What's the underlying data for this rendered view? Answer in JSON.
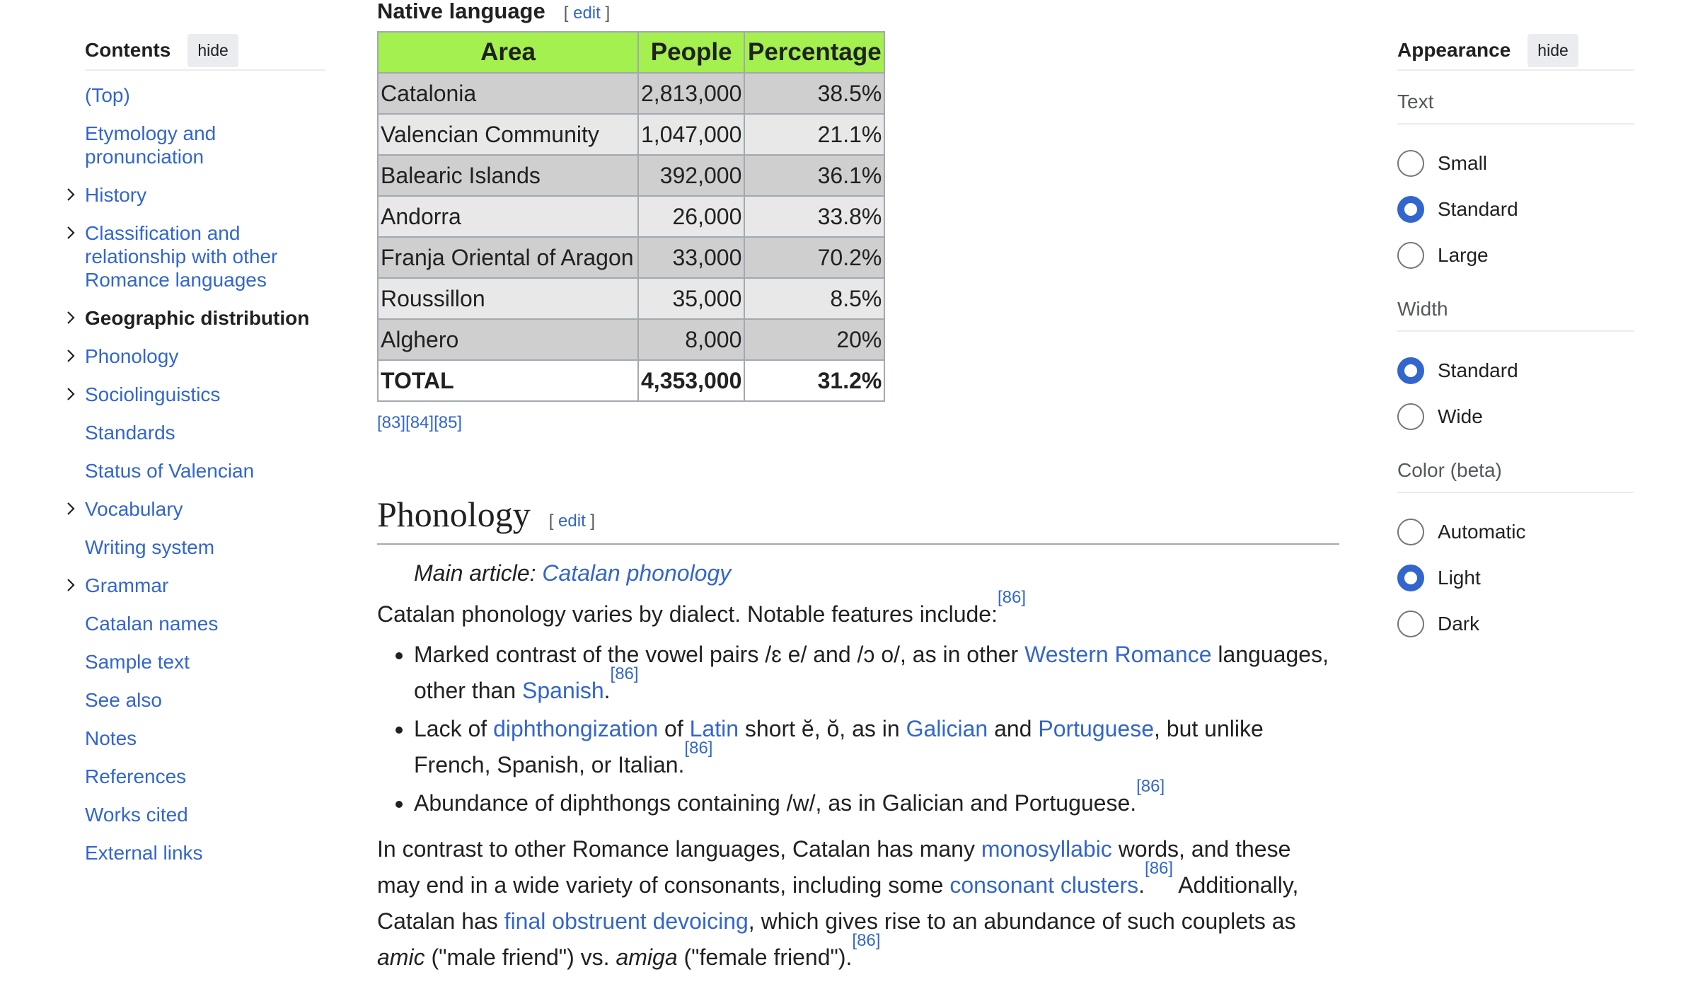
{
  "toc": {
    "title": "Contents",
    "hide_label": "hide",
    "items": [
      {
        "label": "(Top)",
        "expandable": false,
        "active": false
      },
      {
        "label": "Etymology and pronunciation",
        "expandable": false,
        "active": false
      },
      {
        "label": "History",
        "expandable": true,
        "active": false
      },
      {
        "label": "Classification and relationship with other Romance languages",
        "expandable": true,
        "active": false
      },
      {
        "label": "Geographic distribution",
        "expandable": true,
        "active": true
      },
      {
        "label": "Phonology",
        "expandable": true,
        "active": false
      },
      {
        "label": "Sociolinguistics",
        "expandable": true,
        "active": false
      },
      {
        "label": "Standards",
        "expandable": false,
        "active": false
      },
      {
        "label": "Status of Valencian",
        "expandable": false,
        "active": false
      },
      {
        "label": "Vocabulary",
        "expandable": true,
        "active": false
      },
      {
        "label": "Writing system",
        "expandable": false,
        "active": false
      },
      {
        "label": "Grammar",
        "expandable": true,
        "active": false
      },
      {
        "label": "Catalan names",
        "expandable": false,
        "active": false
      },
      {
        "label": "Sample text",
        "expandable": false,
        "active": false
      },
      {
        "label": "See also",
        "expandable": false,
        "active": false
      },
      {
        "label": "Notes",
        "expandable": false,
        "active": false
      },
      {
        "label": "References",
        "expandable": false,
        "active": false
      },
      {
        "label": "Works cited",
        "expandable": false,
        "active": false
      },
      {
        "label": "External links",
        "expandable": false,
        "active": false
      }
    ]
  },
  "native": {
    "heading": "Native language",
    "edit_open": "[ ",
    "edit_label": "edit",
    "edit_close": " ]",
    "table": {
      "headers": [
        "Area",
        "People",
        "Percentage"
      ],
      "rows": [
        [
          "Catalonia",
          "2,813,000",
          "38.5%"
        ],
        [
          "Valencian Community",
          "1,047,000",
          "21.1%"
        ],
        [
          "Balearic Islands",
          "392,000",
          "36.1%"
        ],
        [
          "Andorra",
          "26,000",
          "33.8%"
        ],
        [
          "Franja Oriental of Aragon",
          "33,000",
          "70.2%"
        ],
        [
          "Roussillon",
          "35,000",
          "8.5%"
        ],
        [
          "Alghero",
          "8,000",
          "20%"
        ]
      ],
      "total": [
        "TOTAL",
        "4,353,000",
        "31.2%"
      ],
      "header_bg": "#a3f04e"
    },
    "refs": [
      "[83]",
      "[84]",
      "[85]"
    ]
  },
  "phonology": {
    "heading": "Phonology",
    "edit_open": "[ ",
    "edit_label": "edit",
    "edit_close": " ]",
    "hatnote_prefix": "Main article: ",
    "hatnote_link": "Catalan phonology",
    "intro": "Catalan phonology varies by dialect. Notable features include:",
    "intro_ref": "[86]",
    "b1_a": "Marked contrast of the vowel pairs /ɛ e/ and /ɔ o/, as in other ",
    "b1_link1": "Western Romance",
    "b1_b": " languages, other than ",
    "b1_link2": "Spanish",
    "b1_c": ".",
    "b1_ref": "[86]",
    "b2_a": "Lack of ",
    "b2_link1": "diphthongization",
    "b2_b": " of ",
    "b2_link2": "Latin",
    "b2_c": " short ĕ, ŏ, as in ",
    "b2_link3": "Galician",
    "b2_d": " and ",
    "b2_link4": "Portuguese",
    "b2_e": ", but unlike French, Spanish, or Italian.",
    "b2_ref": "[86]",
    "b3_a": "Abundance of diphthongs containing /w/, as in Galician and Portuguese.",
    "b3_ref": "[86]",
    "p2_a": "In contrast to other Romance languages, Catalan has many ",
    "p2_link1": "monosyllabic",
    "p2_b": " words, and these may end in a wide variety of consonants, including some ",
    "p2_link2": "consonant clusters",
    "p2_c": ".",
    "p2_ref1": "[86]",
    "p2_d": " Additionally, Catalan has ",
    "p2_link3": "final obstruent devoicing",
    "p2_e": ", which gives rise to an abundance of such couplets as ",
    "p2_it1": "amic",
    "p2_f": " (\"male friend\") vs. ",
    "p2_it2": "amiga",
    "p2_g": " (\"female friend\").",
    "p2_ref2": "[86]"
  },
  "appearance": {
    "title": "Appearance",
    "hide_label": "hide",
    "groups": [
      {
        "label": "Text",
        "options": [
          {
            "label": "Small",
            "checked": false
          },
          {
            "label": "Standard",
            "checked": true
          },
          {
            "label": "Large",
            "checked": false
          }
        ]
      },
      {
        "label": "Width",
        "options": [
          {
            "label": "Standard",
            "checked": true
          },
          {
            "label": "Wide",
            "checked": false
          }
        ]
      },
      {
        "label": "Color (beta)",
        "options": [
          {
            "label": "Automatic",
            "checked": false
          },
          {
            "label": "Light",
            "checked": true
          },
          {
            "label": "Dark",
            "checked": false
          }
        ]
      }
    ]
  },
  "colors": {
    "link": "#3366cc",
    "radio_selected": "#3366cc"
  }
}
